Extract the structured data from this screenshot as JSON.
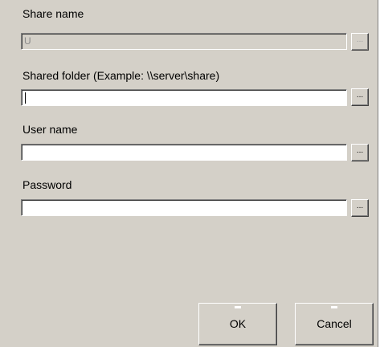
{
  "share_name": {
    "label": "Share name",
    "value": "U",
    "browse_label": "..."
  },
  "shared_folder": {
    "label": "Shared folder (Example:  \\\\server\\share)",
    "value": "",
    "browse_label": "..."
  },
  "user_name": {
    "label": "User name",
    "value": "",
    "browse_label": "..."
  },
  "password": {
    "label": "Password",
    "value": "",
    "browse_label": "..."
  },
  "buttons": {
    "ok": "OK",
    "cancel": "Cancel"
  },
  "colors": {
    "dialog_background": "#d4d0c8",
    "field_background": "#ffffff",
    "disabled_text": "#8a8a8a"
  }
}
